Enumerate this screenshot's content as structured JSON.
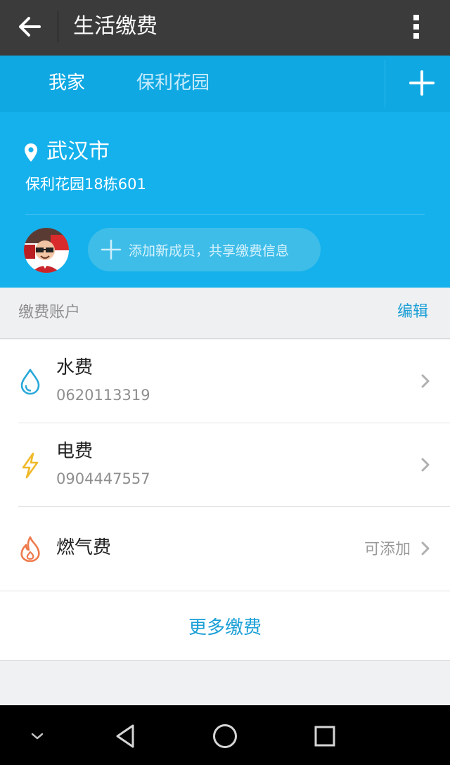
{
  "header": {
    "title": "生活缴费",
    "back_icon": "arrow-left-icon",
    "more_icon": "more-vertical-icon"
  },
  "tabs": [
    {
      "label": "我家",
      "active": true
    },
    {
      "label": "保利花园",
      "active": false
    }
  ],
  "home": {
    "city": "武汉市",
    "address": "保利花园18栋601",
    "add_member_label": "添加新成员，共享缴费信息"
  },
  "accounts_section": {
    "title": "缴费账户",
    "edit_label": "编辑"
  },
  "accounts": [
    {
      "name": "水费",
      "account": "0620113319",
      "icon": "water-drop-icon",
      "color": "#29a8d8"
    },
    {
      "name": "电费",
      "account": "0904447557",
      "icon": "lightning-icon",
      "color": "#f0b92a"
    },
    {
      "name": "燃气费",
      "hint": "可添加",
      "icon": "flame-icon",
      "color": "#ee7a4c"
    }
  ],
  "more_fees_label": "更多缴费",
  "colors": {
    "accent": "#1a9fd6",
    "tab_bar": "#0fa8e2",
    "card": "#14b1ec",
    "topbar": "#3b3b3b"
  }
}
